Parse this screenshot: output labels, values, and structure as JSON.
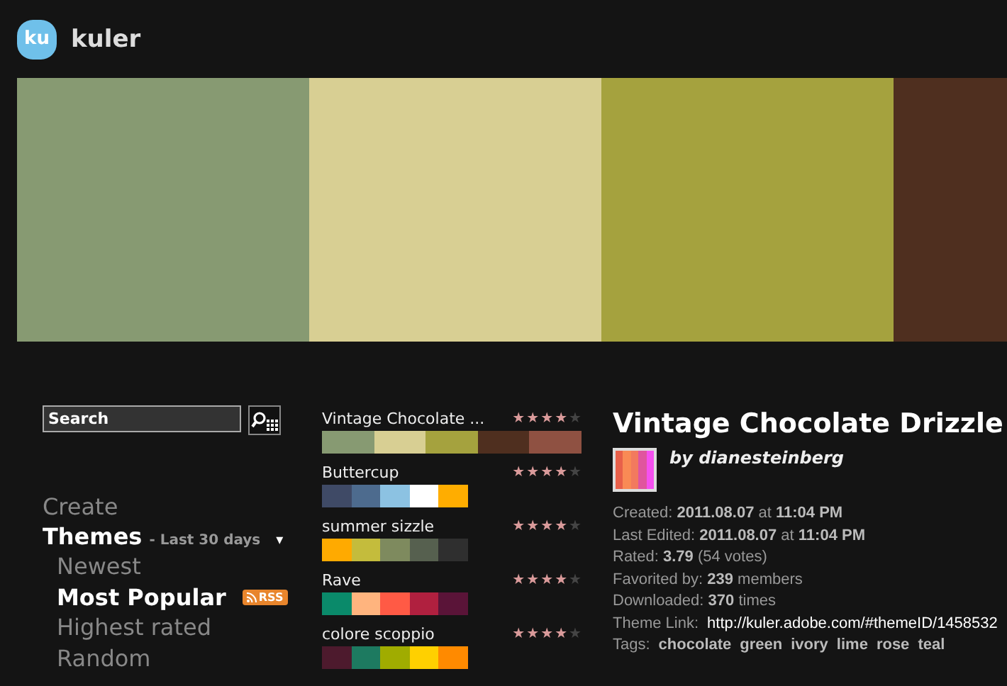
{
  "header": {
    "logo_badge": "ku",
    "logo_text": "kuler"
  },
  "hero": {
    "swatches": [
      {
        "color": "#879a72"
      },
      {
        "color": "#d8cf93"
      },
      {
        "color": "#a5a23e"
      },
      {
        "color": "#4f2f1f"
      }
    ]
  },
  "search": {
    "placeholder": "Search"
  },
  "nav": {
    "create": "Create",
    "themes": "Themes",
    "range": "- Last 30 days",
    "dropdown": "▾",
    "items": [
      {
        "label": "Newest",
        "selected": false
      },
      {
        "label": "Most Popular",
        "selected": true,
        "rss": "RSS"
      },
      {
        "label": "Highest rated",
        "selected": false
      },
      {
        "label": "Random",
        "selected": false
      }
    ]
  },
  "themes": [
    {
      "name": "Vintage Chocolate ...",
      "stars": 4,
      "selected": true,
      "colors": [
        {
          "color": "#879a72"
        },
        {
          "color": "#d8cf93"
        },
        {
          "color": "#a5a23e"
        },
        {
          "color": "#4f2f1f"
        },
        {
          "color": "#8f5142"
        }
      ]
    },
    {
      "name": "Buttercup",
      "stars": 4,
      "selected": false,
      "colors": [
        {
          "color": "#3f4a66"
        },
        {
          "color": "#4d6b8e"
        },
        {
          "color": "#8cc2e2"
        },
        {
          "color": "#ffffff"
        },
        {
          "color": "#ffad00"
        }
      ]
    },
    {
      "name": "summer sizzle",
      "stars": 4,
      "selected": false,
      "colors": [
        {
          "color": "#ffaa00"
        },
        {
          "color": "#c4bc3c"
        },
        {
          "color": "#7e8a5e"
        },
        {
          "color": "#56604f"
        },
        {
          "color": "#2f2f2f"
        }
      ]
    },
    {
      "name": "Rave",
      "stars": 4,
      "selected": false,
      "colors": [
        {
          "color": "#0a8a6a"
        },
        {
          "color": "#ffb47e"
        },
        {
          "color": "#ff5a45"
        },
        {
          "color": "#b0203f"
        },
        {
          "color": "#5a1438"
        }
      ]
    },
    {
      "name": "colore scoppio",
      "stars": 4,
      "selected": false,
      "colors": [
        {
          "color": "#4d1a2d"
        },
        {
          "color": "#1d7a60"
        },
        {
          "color": "#a0ac00"
        },
        {
          "color": "#ffd000"
        },
        {
          "color": "#ff8a00"
        }
      ]
    }
  ],
  "detail": {
    "title": "Vintage Chocolate Drizzle",
    "author": "by dianesteinberg",
    "thumbnail": [
      {
        "color": "#e8604a"
      },
      {
        "color": "#f98a55"
      },
      {
        "color": "#f27a5e"
      },
      {
        "color": "#e0559e"
      },
      {
        "color": "#f550f0"
      }
    ],
    "lines": [
      "Created: **2011.08.07** at **11:04 PM**",
      "Last Edited: **2011.08.07** at **11:04 PM**",
      "Rated: **3.79** (54 votes)",
      "Favorited by: **239** members",
      "Downloaded: **370** times"
    ],
    "link_label": "Theme Link:",
    "link": "http://kuler.adobe.com/#themeID/1458532",
    "tags_label": "Tags:",
    "tags": [
      "chocolate",
      "green",
      "ivory",
      "lime",
      "rose",
      "teal"
    ]
  }
}
